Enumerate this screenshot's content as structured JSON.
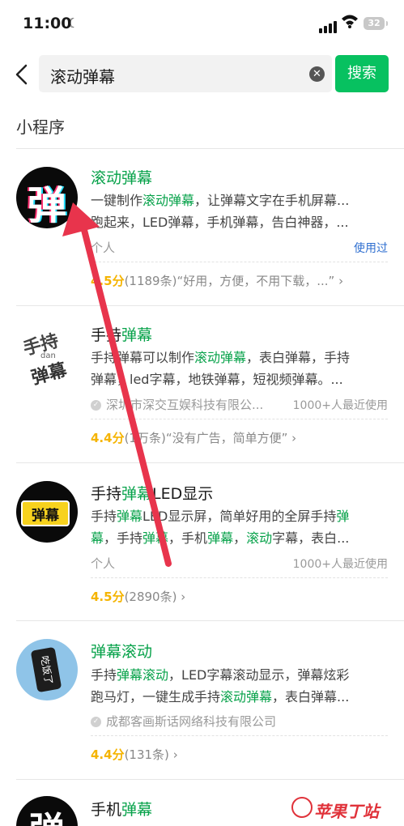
{
  "status_bar": {
    "time": "11:00",
    "battery": "32"
  },
  "search": {
    "query": "滚动弹幕",
    "button_label": "搜索"
  },
  "section": {
    "title": "小程序"
  },
  "results": [
    {
      "title_hl": "滚动弹幕",
      "desc_line1_pre": "一键制作",
      "desc_line1_hl": "滚动弹幕",
      "desc_line1_post": "，让弹幕文字在手机屏幕...",
      "desc_line2": "跑起来，LED弹幕，手机弹幕，告白神器，...",
      "developer": "个人",
      "tag": "使用过",
      "score": "4.5分",
      "rating_text": "(1189条)“好用，方便，不用下载，...”"
    },
    {
      "title_pre": "手持",
      "title_hl": "弹幕",
      "desc_line1_pre": "手持弹幕可以制作",
      "desc_line1_hl": "滚动弹幕",
      "desc_line1_post": "，表白弹幕，手持",
      "desc_line2": "弹幕，led字幕，地铁弹幕，短视频弹幕。...",
      "developer": "深圳市深交互娱科技有限公...",
      "users": "1000+人最近使用",
      "score": "4.4分",
      "rating_text": "(1万条)“没有广告，简单方便”"
    },
    {
      "title_pre": "手持",
      "title_hl": "弹幕",
      "title_post": "LED显示",
      "desc_line1_pre": "手持",
      "desc_line1_hl": "弹幕",
      "desc_line1_post": "LED显示屏，简单好用的全屏手持",
      "desc_line1_hl2": "弹",
      "desc_line2_hl1": "幕",
      "desc_line2_a": "，手持",
      "desc_line2_hl2": "弹幕",
      "desc_line2_b": "，手机",
      "desc_line2_hl3": "弹幕",
      "desc_line2_c": "，",
      "desc_line2_hl4": "滚动",
      "desc_line2_d": "字幕，表白...",
      "developer": "个人",
      "users": "1000+人最近使用",
      "score": "4.5分",
      "rating_text": "(2890条)"
    },
    {
      "title_hl": "弹幕滚动",
      "desc_line1_pre": "手持",
      "desc_line1_hl": "弹幕滚动",
      "desc_line1_post": "，LED字幕滚动显示，弹幕炫彩",
      "desc_line2_a": "跑马灯，一键生成手持",
      "desc_line2_hl": "滚动弹幕",
      "desc_line2_b": "，表白弹幕...",
      "developer": "成都客画斯话网络科技有限公司",
      "score": "4.4分",
      "rating_text": "(131条)"
    },
    {
      "title_pre": "手机",
      "title_hl": "弹幕"
    }
  ],
  "icons": {
    "icon1_text": "弹",
    "icon2_text_top": "手持",
    "icon2_text_mid": "dan",
    "icon2_text_bot": "弹幕",
    "icon3_text": "弹幕",
    "icon4_text": "吃饭了",
    "icon5_text": "弹"
  },
  "watermark": "苹果丁站",
  "colors": {
    "accent": "#07c160",
    "highlight": "#07a24a",
    "score": "#f5b400",
    "arrow": "#e8344c"
  }
}
